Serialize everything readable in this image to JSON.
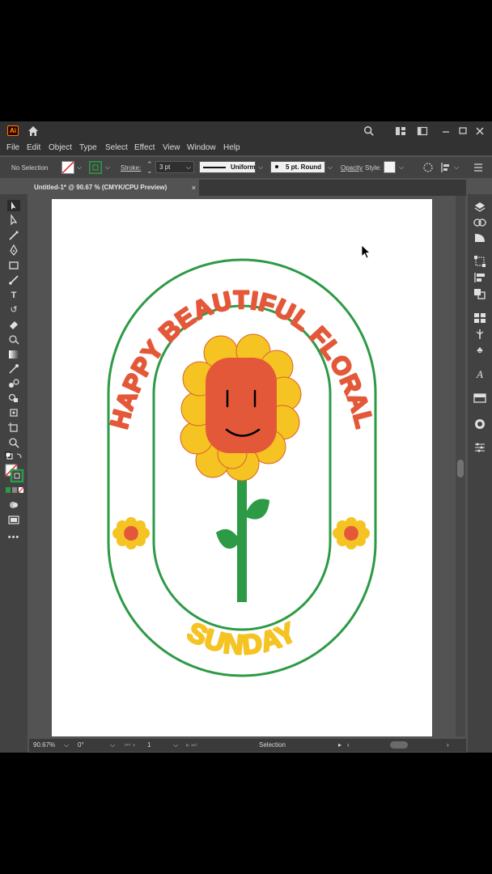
{
  "app": {
    "logo_text": "Ai"
  },
  "menu": [
    "File",
    "Edit",
    "Object",
    "Type",
    "Select",
    "Effect",
    "View",
    "Window",
    "Help"
  ],
  "control": {
    "selection_label": "No Selection",
    "stroke_label": "Stroke:",
    "stroke_weight": "3 pt",
    "profile": "Uniform",
    "brush": "5 pt. Round",
    "opacity_label": "Opacity",
    "style_label": "Style:"
  },
  "document_tab": {
    "title": "Untitled-1* @ 90.67 % (CMYK/CPU Preview)",
    "close": "×"
  },
  "artwork": {
    "arc_text_top": "HAPPY BEAUTIFUL FLORAL",
    "arc_text_bottom": "SUNDAY",
    "colors": {
      "red": "#e4583a",
      "yellow": "#f5c322",
      "green": "#2d9a46",
      "petal_line": "#d8632f"
    }
  },
  "status": {
    "zoom": "90.67%",
    "rotation": "0°",
    "artboard_number": "1",
    "tool": "Selection"
  },
  "icons": {
    "tools": [
      "selection-tool-icon",
      "direct-selection-tool-icon",
      "magic-wand-icon",
      "pen-tool-icon",
      "rectangle-tool-icon",
      "brush-tool-icon",
      "type-tool-icon",
      "rotate-tool-icon",
      "eraser-tool-icon",
      "warp-tool-icon",
      "gradient-tool-icon",
      "eyedropper-tool-icon",
      "blend-tool-icon",
      "shape-builder-icon",
      "artboard-tool-icon",
      "zoom-tool-icon"
    ],
    "panels": [
      "layers-icon",
      "libraries-icon",
      "properties-icon",
      "transform-icon",
      "align-icon",
      "pathfinder-icon",
      "swatches-icon",
      "brushes-icon",
      "symbols-icon",
      "character-icon",
      "stroke-panel-icon",
      "appearance-icon",
      "adjustments-icon"
    ]
  }
}
